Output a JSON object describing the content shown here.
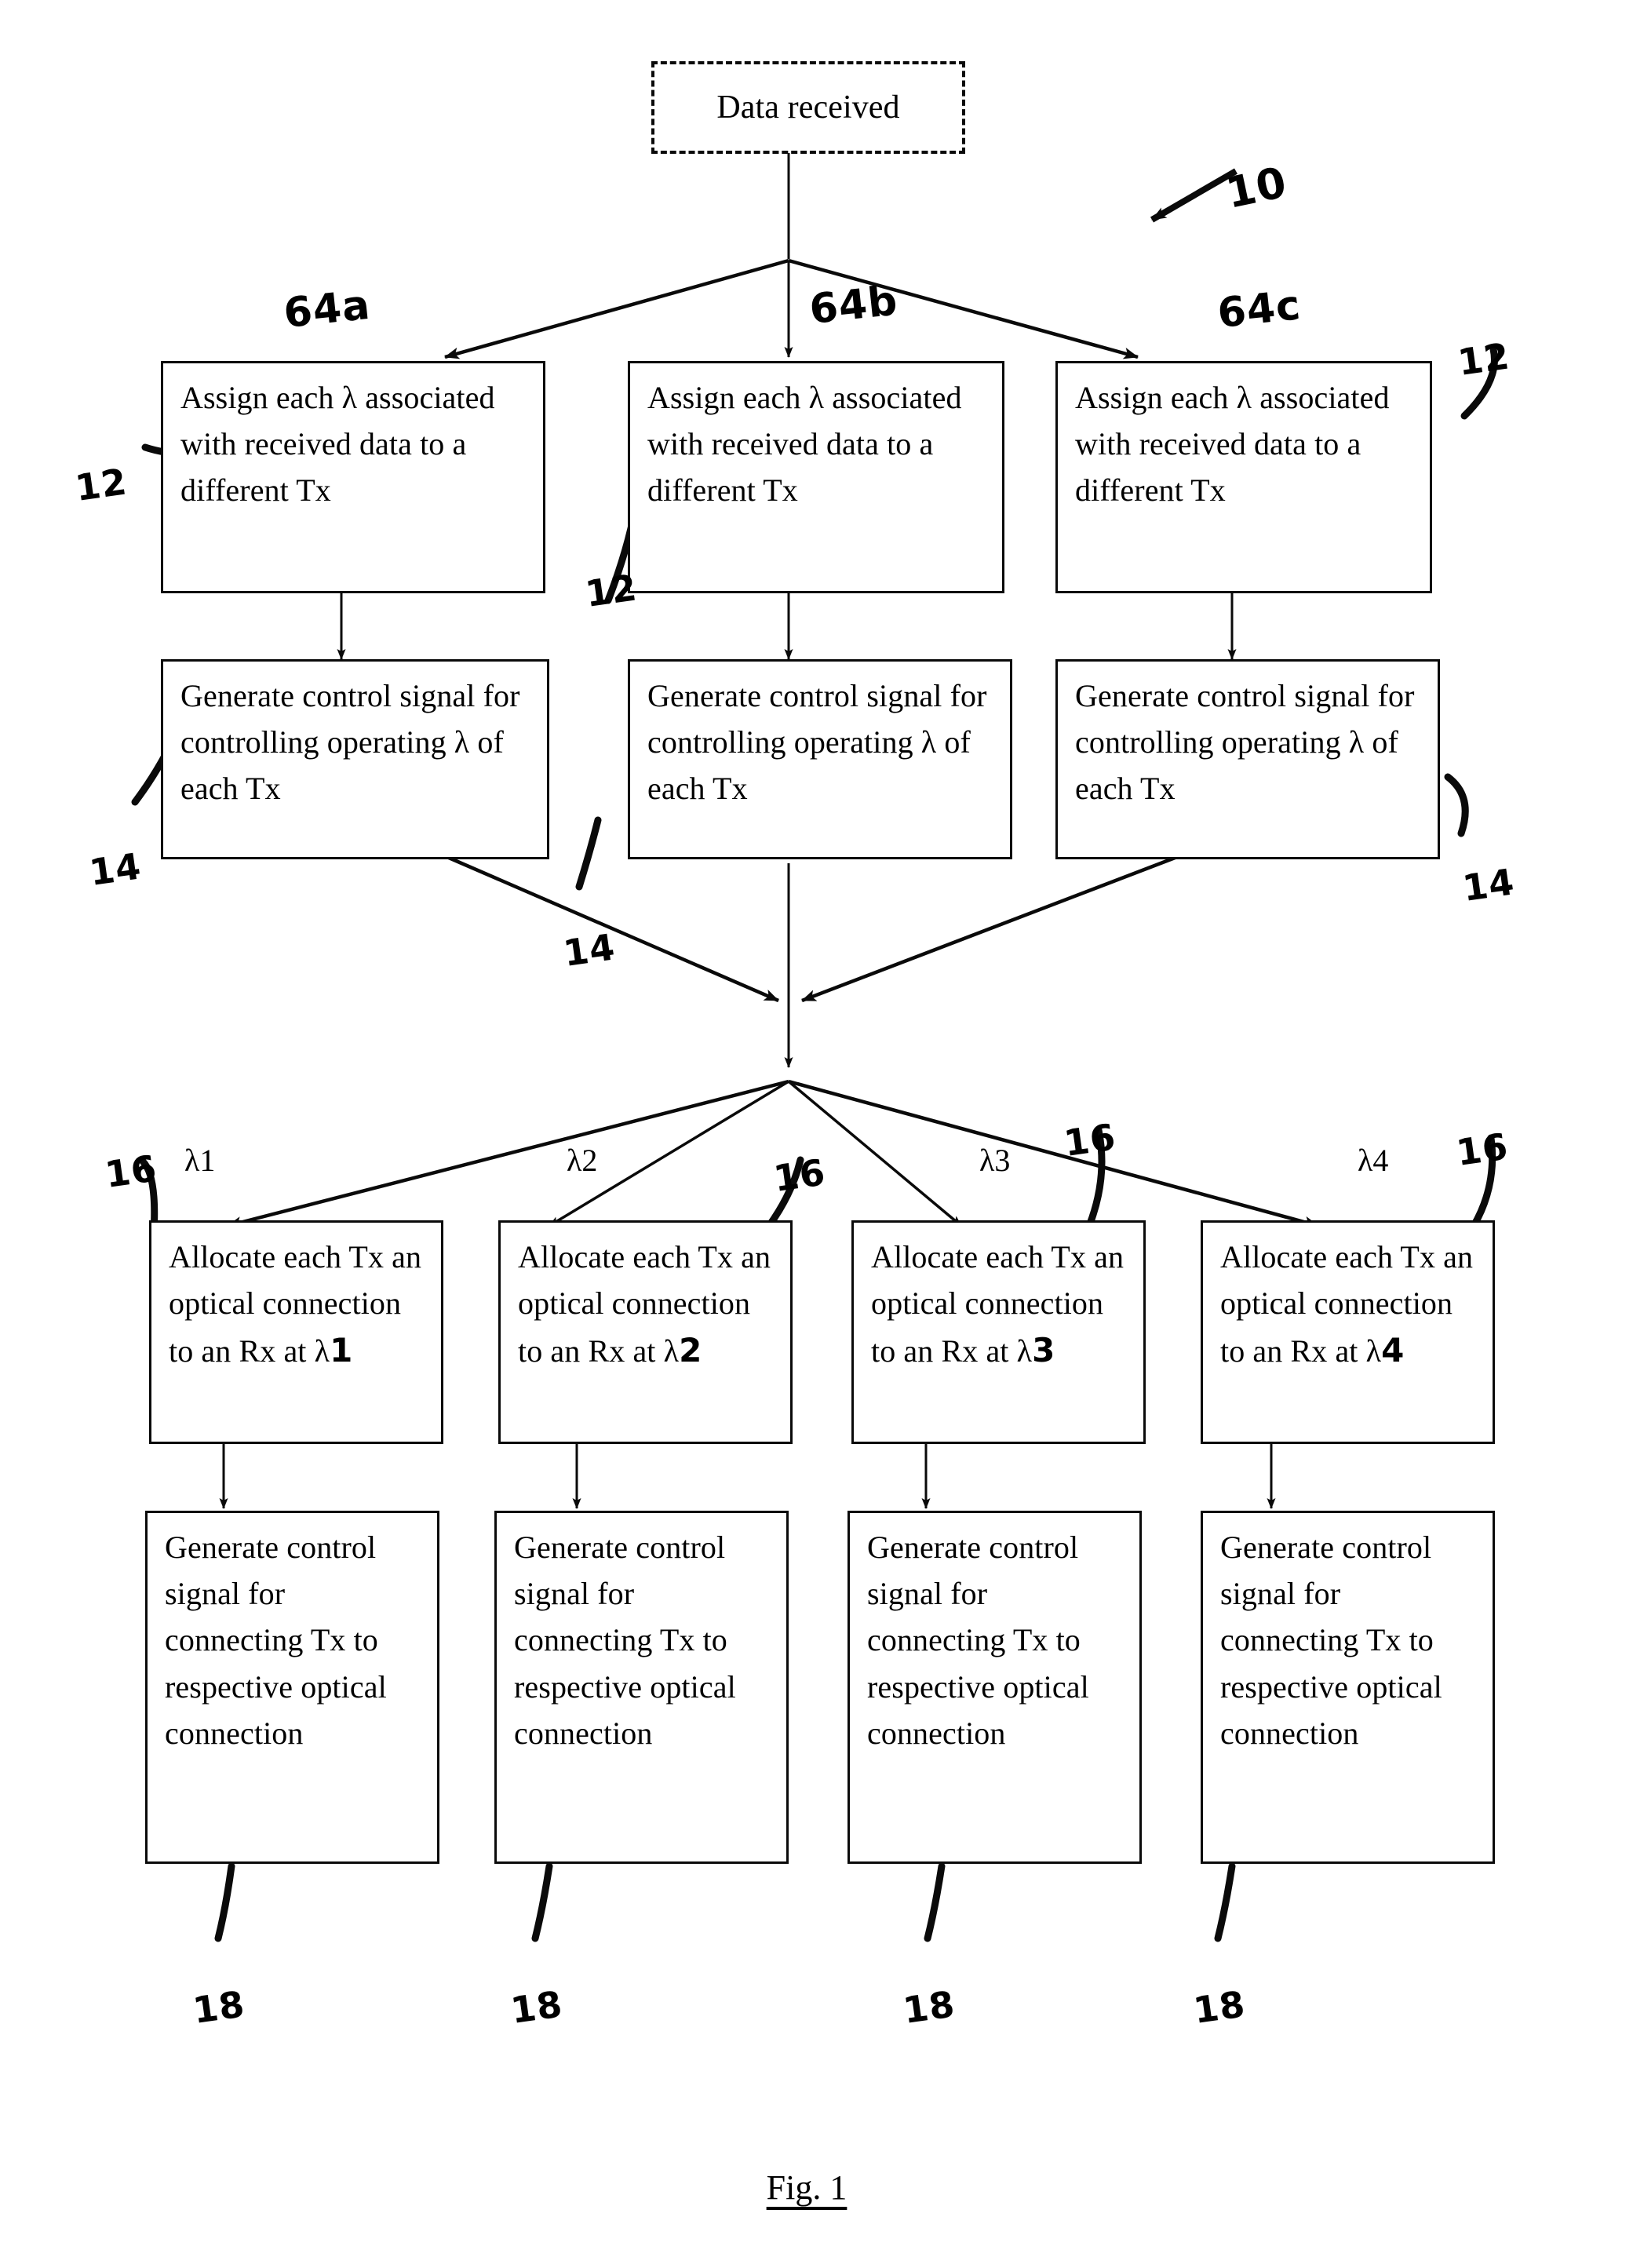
{
  "figure": {
    "caption": "Fig. 1",
    "reference_numeral_main": "10"
  },
  "start_node": {
    "label": "Data received",
    "style": "dashed"
  },
  "branch_labels": [
    {
      "id": "64a",
      "text": "64a"
    },
    {
      "id": "64b",
      "text": "64b"
    },
    {
      "id": "64c",
      "text": "64c"
    }
  ],
  "row_assign": {
    "ref": "12",
    "boxes": [
      {
        "text": "Assign each λ associated with received data to a different Tx"
      },
      {
        "text": "Assign each λ associated with received data to a different Tx"
      },
      {
        "text": "Assign each λ associated with received data to a different Tx"
      }
    ]
  },
  "row_control": {
    "ref": "14",
    "boxes": [
      {
        "text": "Generate control signal for controlling operating λ of each Tx"
      },
      {
        "text": "Generate control signal for controlling operating λ of each Tx"
      },
      {
        "text": "Generate control signal for controlling operating λ of each Tx"
      }
    ]
  },
  "wavelength_labels": [
    {
      "text": "λ1"
    },
    {
      "text": "λ2"
    },
    {
      "text": "λ3"
    },
    {
      "text": "λ4"
    }
  ],
  "row_allocate": {
    "ref": "16",
    "boxes": [
      {
        "prefix": "Allocate each Tx an optical connection to an Rx at λ",
        "suffix": "1"
      },
      {
        "prefix": "Allocate each Tx an optical connection to an Rx at λ",
        "suffix": "2"
      },
      {
        "prefix": "Allocate each Tx an optical connection to an Rx at λ",
        "suffix": "3"
      },
      {
        "prefix": "Allocate each Tx an optical connection to an Rx at λ",
        "suffix": "4"
      }
    ]
  },
  "row_connect": {
    "ref": "18",
    "boxes": [
      {
        "text": "Generate control signal for connecting Tx to respective optical connection"
      },
      {
        "text": "Generate control signal for connecting Tx to respective optical connection"
      },
      {
        "text": "Generate control signal for connecting Tx to respective optical connection"
      },
      {
        "text": "Generate control signal for connecting Tx to respective optical connection"
      }
    ]
  },
  "reference_numerals": {
    "assign_left": "12",
    "assign_mid": "12",
    "assign_right": "12",
    "control_left": "14",
    "control_mid": "14",
    "control_right": "14",
    "allocate_1": "16",
    "allocate_2": "16",
    "allocate_3": "16",
    "allocate_4": "16",
    "connect_1": "18",
    "connect_2": "18",
    "connect_3": "18",
    "connect_4": "18"
  },
  "colors": {
    "ink": "#0a0a0a",
    "paper": "#ffffff"
  }
}
